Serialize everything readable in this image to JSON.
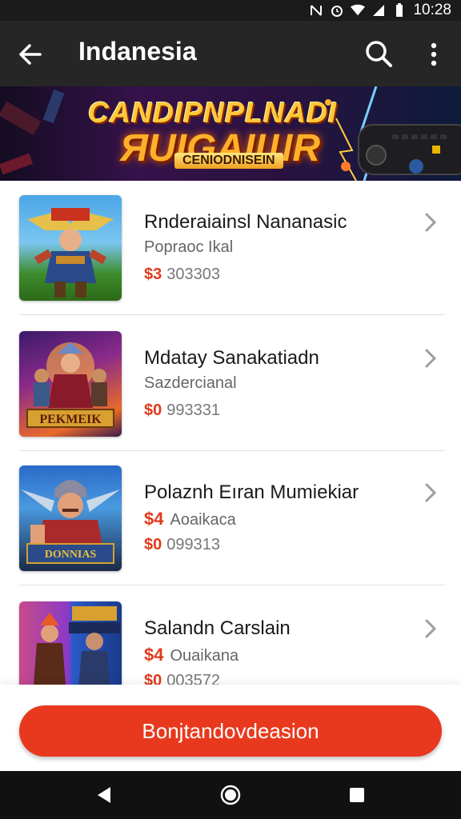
{
  "status_bar": {
    "time": "10:28",
    "icons": [
      "nfc-icon",
      "alarm-icon",
      "wifi-icon",
      "signal-icon",
      "battery-icon"
    ]
  },
  "app_bar": {
    "title": "Indanesia",
    "icons": [
      "back-arrow-icon",
      "search-icon",
      "more-vert-icon"
    ]
  },
  "banner": {
    "title_line1": "CANDIPNPLNADI",
    "title_line2": "ЯUIGAIШR",
    "subtitle": "CENIODNISEIN"
  },
  "items": [
    {
      "name": "Rnderaiainsl Nananasic",
      "subtitle": "Popraoc Ikal",
      "currency": "$3",
      "price": "303303"
    },
    {
      "name": "Mdatay Sanakatiadn",
      "subtitle": "Sazdercianal",
      "currency": "$0",
      "price": "993331"
    },
    {
      "name": "Polaznh Eıran Mumiekiar",
      "subtitle_currency": "$4",
      "subtitle": "Aoaikaca",
      "currency": "$0",
      "price": "099313"
    },
    {
      "name": "Salandn Carslain",
      "subtitle_currency": "$4",
      "subtitle": "Ouaikana",
      "currency": "$0",
      "price": "003572"
    }
  ],
  "cta": {
    "label": "Bonjtandovdeasion"
  },
  "colors": {
    "accent": "#e8391e",
    "app_bar": "#262626",
    "status_bar": "#1b1b1b"
  }
}
